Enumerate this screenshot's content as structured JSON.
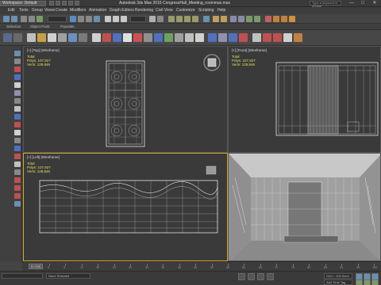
{
  "titlebar": {
    "workspace": "Workspace: Default",
    "app_title": "Autodesk 3ds Max 2016    CongressHall_Meeting_roommax.max",
    "search_placeholder": "Type a keyword or phrase",
    "minimize": "—",
    "maximize": "□",
    "close": "✕"
  },
  "menu": [
    "Edit",
    "Tools",
    "Group",
    "Views",
    "Create",
    "Modifiers",
    "Animation",
    "Graph Editors",
    "Rendering",
    "Civil View",
    "Customize",
    "Scripting",
    "Help"
  ],
  "subbar": [
    "Selection",
    "Object Paint",
    "Populate"
  ],
  "viewports": {
    "top": {
      "label": "[+] [Top] [Wireframe]",
      "total_label": "Total",
      "polys": "Polys:  107,927",
      "verts": "Verts:  129,846"
    },
    "front": {
      "label": "[+] [Front] [Wireframe]",
      "total_label": "Total",
      "polys": "Polys:  107,927",
      "verts": "Verts:  129,846"
    },
    "left": {
      "label": "[+] [Left] [Wireframe]",
      "total_label": "Total",
      "polys": "Polys:  107,927",
      "verts": "Verts:  129,846"
    },
    "persp": {
      "label": ""
    }
  },
  "timeline": {
    "slider_label": "0 / 100",
    "ticks": [
      "0",
      "5",
      "10",
      "15",
      "20",
      "25",
      "30",
      "35",
      "40",
      "45",
      "50",
      "55",
      "60",
      "65",
      "70",
      "75",
      "80",
      "85",
      "90",
      "95",
      "100"
    ]
  },
  "status": {
    "maxscript": "",
    "selection": "None Selected",
    "grid": "Grid = 100.0mm",
    "addtime": "Add Time Tag"
  },
  "colors": {
    "accent_active": "#d8a825",
    "stats_text": "#e0e060"
  }
}
